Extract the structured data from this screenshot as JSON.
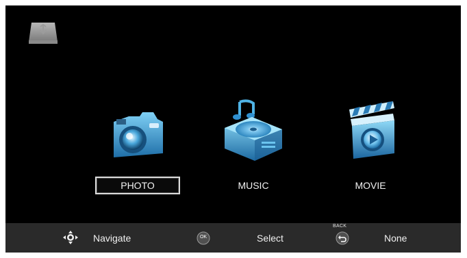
{
  "source": {
    "device_icon": "usb-drive-icon"
  },
  "menu": {
    "items": [
      {
        "label": "PHOTO",
        "icon": "camera-icon",
        "selected": true
      },
      {
        "label": "MUSIC",
        "icon": "music-player-icon",
        "selected": false
      },
      {
        "label": "MOVIE",
        "icon": "clapperboard-icon",
        "selected": false
      }
    ]
  },
  "bottom_bar": {
    "navigate": {
      "icon": "dpad-icon",
      "label": "Navigate"
    },
    "select": {
      "icon": "ok-button-icon",
      "icon_text": "OK",
      "label": "Select"
    },
    "back": {
      "icon": "back-button-icon",
      "key_label": "BACK",
      "label": "None"
    }
  },
  "colors": {
    "background": "#000000",
    "bar": "#2a2a2a",
    "icon_blue": "#3aa0d8",
    "selection_border": "#dcdcdc"
  }
}
